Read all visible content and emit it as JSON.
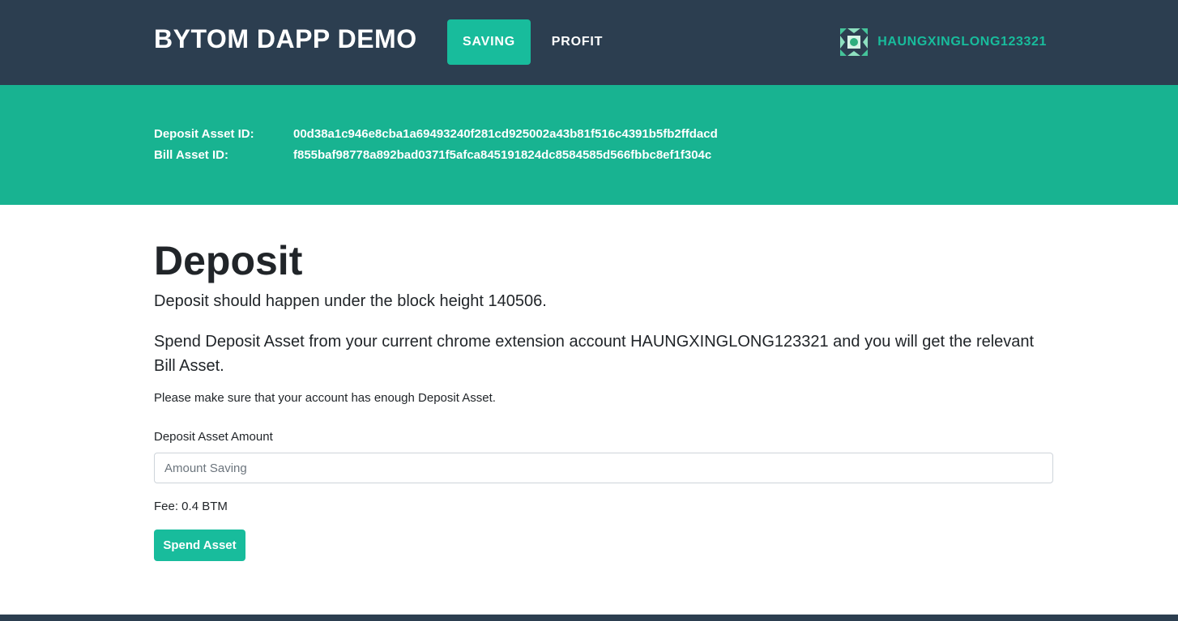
{
  "navbar": {
    "brand": "BYTOM DAPP DEMO",
    "tabs": [
      {
        "label": "SAVING",
        "active": true
      },
      {
        "label": "PROFIT",
        "active": false
      }
    ],
    "account_name": "HAUNGXINGLONG123321",
    "account_icon": "identicon-avatar"
  },
  "banner": {
    "deposit_asset_label": "Deposit Asset ID:",
    "deposit_asset_id": "00d38a1c946e8cba1a69493240f281cd925002a43b81f516c4391b5fb2ffdacd",
    "bill_asset_label": "Bill Asset ID:",
    "bill_asset_id": "f855baf98778a892bad0371f5afca845191824dc8584585d566fbbc8ef1f304c"
  },
  "main": {
    "title": "Deposit",
    "height_text": "Deposit should happen under the block height 140506.",
    "spend_text": "Spend Deposit Asset from your current chrome extension account HAUNGXINGLONG123321 and you will get the relevant Bill Asset.",
    "enough_text": "Please make sure that your account has enough Deposit Asset.",
    "amount_label": "Deposit Asset Amount",
    "amount_placeholder": "Amount Saving",
    "fee_text": "Fee: 0.4 BTM",
    "spend_button": "Spend Asset"
  },
  "colors": {
    "navbar_bg": "#2c3e50",
    "accent": "#18bc9c",
    "banner_bg": "#18b391"
  }
}
